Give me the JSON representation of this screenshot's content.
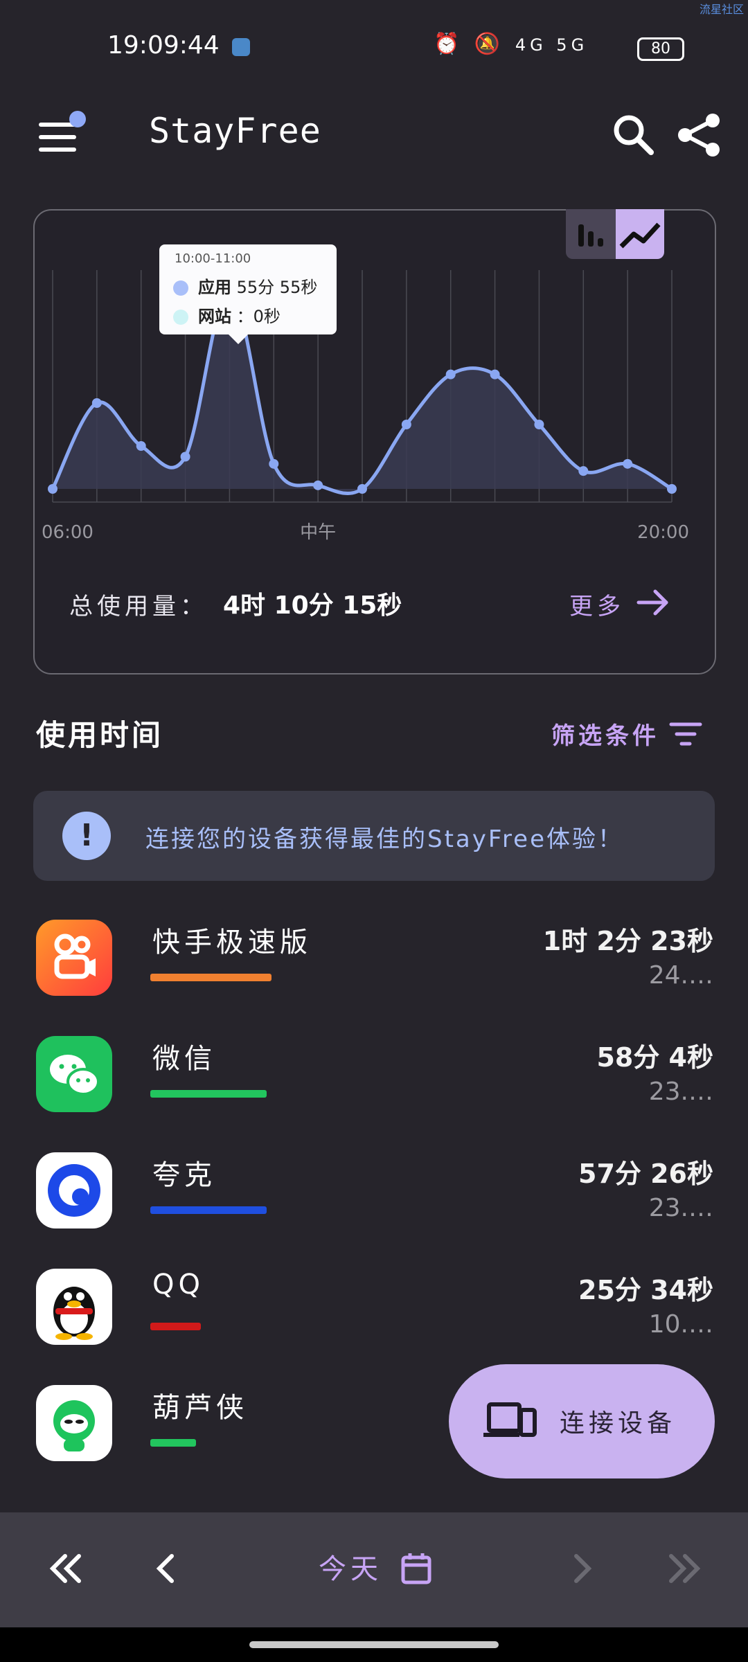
{
  "status_bar": {
    "time": "19:09:44",
    "network": "4G 5G",
    "battery": "80",
    "corner_text": "流星社区"
  },
  "app_bar": {
    "title": "StayFree",
    "menu_icon": "menu-icon",
    "search_icon": "search-icon",
    "share_icon": "share-icon"
  },
  "chart_card": {
    "toggle": [
      "bar-chart-icon",
      "line-chart-icon"
    ],
    "tooltip": {
      "range": "10:00-11:00",
      "app_label": "应用",
      "app_value": "55分 55秒",
      "site_label": "网站",
      "site_value": "0秒"
    },
    "total_label": "总使用量：",
    "total_value": "4时 10分 15秒",
    "more_label": "更多"
  },
  "chart_data": {
    "type": "area",
    "x_tick_labels": [
      "06:00",
      "中午",
      "20:00"
    ],
    "x": [
      "06:00",
      "07:00",
      "08:00",
      "09:00",
      "10:00",
      "11:00",
      "12:00",
      "13:00",
      "14:00",
      "15:00",
      "16:00",
      "17:00",
      "18:00",
      "19:00",
      "20:00"
    ],
    "series": [
      {
        "name": "应用",
        "values": [
          0,
          24,
          12,
          9,
          56,
          7,
          1,
          0,
          18,
          32,
          32,
          18,
          5,
          7,
          0
        ]
      },
      {
        "name": "网站",
        "values": [
          0,
          0,
          0,
          0,
          0,
          0,
          0,
          0,
          0,
          0,
          0,
          0,
          0,
          0,
          0
        ]
      }
    ],
    "ylim": [
      0,
      60
    ],
    "grid": true,
    "colors": {
      "line": "#8aa7f2",
      "fill": "#3a3b52",
      "grid": "#4a4a52"
    }
  },
  "usage_section": {
    "title": "使用时间",
    "filter_label": "筛选条件",
    "banner_text": "连接您的设备获得最佳的StayFree体验！"
  },
  "apps": [
    {
      "name": "快手极速版",
      "duration": "1时 2分 23秒",
      "percent": "24.…",
      "bar_color": "#f08030",
      "fraction": 0.24
    },
    {
      "name": "微信",
      "duration": "58分 4秒",
      "percent": "23.…",
      "bar_color": "#22c55e",
      "fraction": 0.23
    },
    {
      "name": "夸克",
      "duration": "57分 26秒",
      "percent": "23.…",
      "bar_color": "#1f4fe0",
      "fraction": 0.23
    },
    {
      "name": "QQ",
      "duration": "25分 34秒",
      "percent": "10.…",
      "bar_color": "#d11a1a",
      "fraction": 0.1
    },
    {
      "name": "葫芦侠",
      "duration": "",
      "percent": "",
      "bar_color": "#22c55e",
      "fraction": 0.09
    }
  ],
  "fab": {
    "label": "连接设备"
  },
  "bottom_nav": {
    "today_label": "今天"
  }
}
